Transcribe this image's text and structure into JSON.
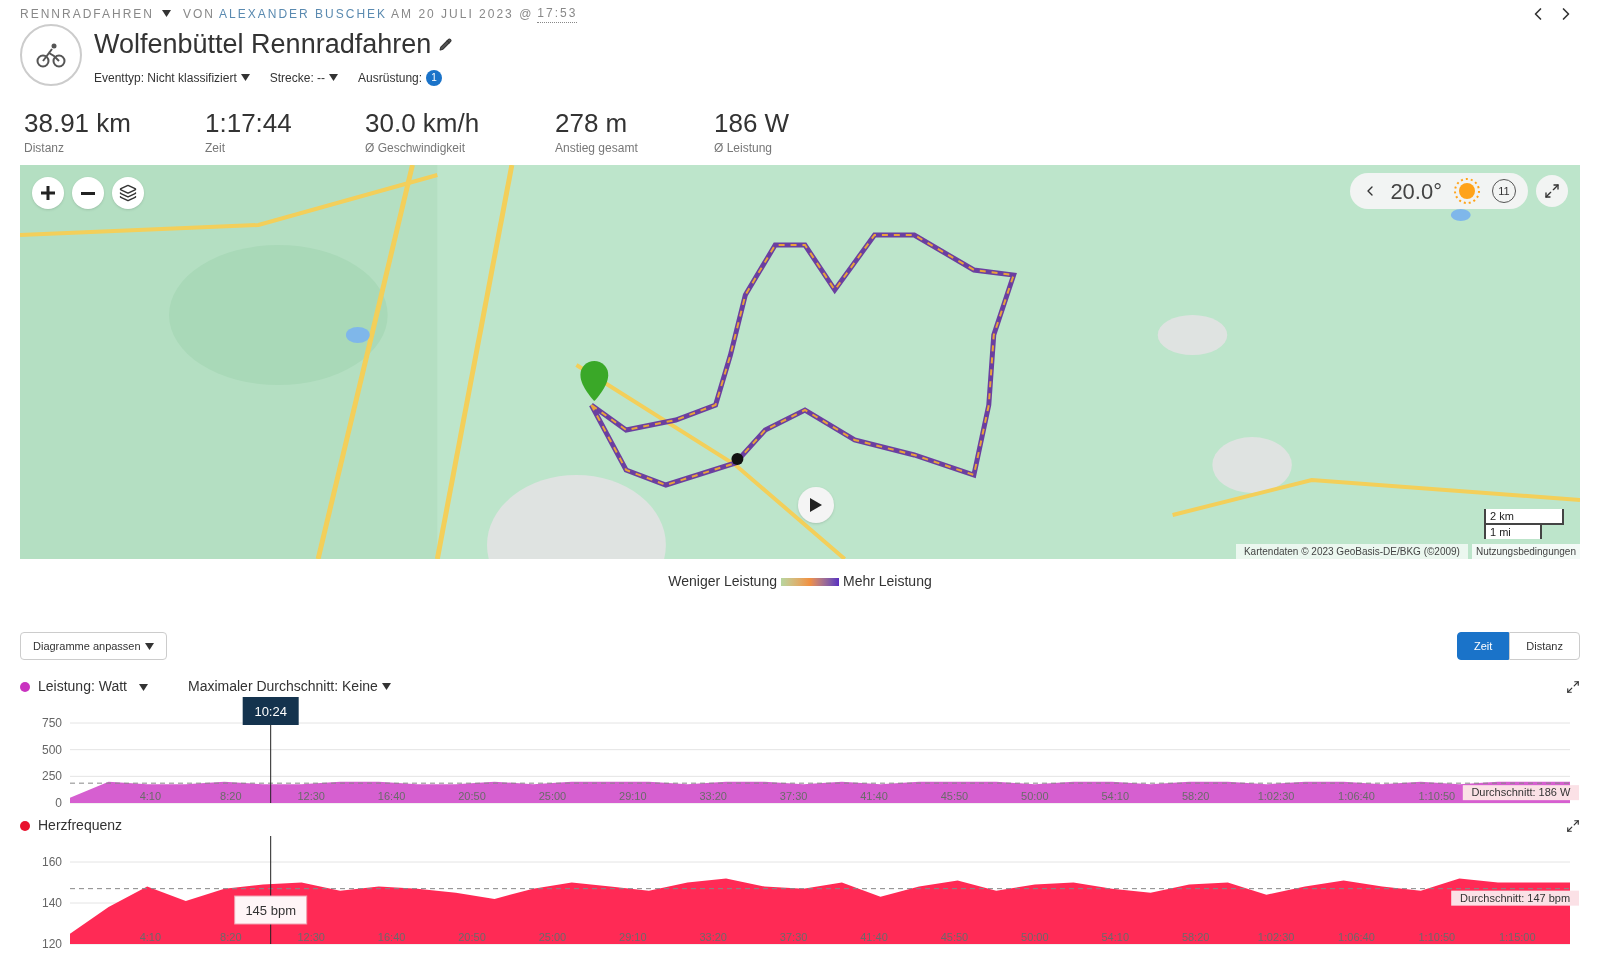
{
  "header": {
    "sport": "RENNRADFAHREN",
    "by": "VON",
    "author": "ALEXANDER BUSCHEK",
    "date": "AM 20 JULI 2023 @",
    "time": "17:53"
  },
  "title": "Wolfenbüttel Rennradfahren",
  "meta": [
    {
      "kind": "dropdown",
      "label": "Eventtyp: Nicht klassifiziert"
    },
    {
      "kind": "dropdown",
      "label": "Strecke: --"
    },
    {
      "kind": "badge",
      "label": "Ausrüstung:",
      "badge": "1"
    }
  ],
  "stats": [
    {
      "value": "38.91 km",
      "label": "Distanz"
    },
    {
      "value": "1:17:44",
      "label": "Zeit"
    },
    {
      "value": "30.0 km/h",
      "label": "Ø Geschwindigkeit"
    },
    {
      "value": "278 m",
      "label": "Anstieg gesamt"
    },
    {
      "value": "186 W",
      "label": "Ø Leistung"
    }
  ],
  "map": {
    "kind": "picture",
    "weather": {
      "temperature": "20.0°",
      "wind": "11"
    },
    "scale": [
      "2 km",
      "1 mi"
    ],
    "attribution": "Kartendaten © 2023 GeoBasis-DE/BKG (©2009)",
    "terms": "Nutzungsbedingungen"
  },
  "legend": {
    "low": "Weniger Leistung",
    "high": "Mehr Leistung"
  },
  "customize_button": "Diagramme anpassen",
  "axis_toggle": [
    {
      "label": "Zeit",
      "selected": true
    },
    {
      "label": "Distanz",
      "selected": false
    }
  ],
  "charts": [
    {
      "title": "Leistung: Watt",
      "selector": "Maximaler Durchschnitt: Keine",
      "color": "#c933c0",
      "cursor_label": "10:24",
      "chart_data": {
        "type": "area",
        "x": [
          0,
          120,
          240,
          360,
          480,
          600,
          720,
          840,
          960,
          1080,
          1200,
          1320,
          1440,
          1560,
          1680,
          1800,
          1920,
          2040,
          2160,
          2280,
          2400,
          2520,
          2640,
          2760,
          2880,
          3000,
          3120,
          3240,
          3360,
          3480,
          3600,
          3720,
          3840,
          3960,
          4080,
          4200,
          4320,
          4440,
          4560,
          4664
        ],
        "series": [
          {
            "color": "#d65fd0",
            "values": [
              50,
              200,
              175,
              175,
              200,
              175,
              175,
              200,
              200,
              175,
              175,
              200,
              175,
              200,
              200,
              200,
              175,
              200,
              200,
              175,
              200,
              175,
              200,
              200,
              200,
              175,
              200,
              200,
              175,
              200,
              200,
              175,
              200,
              200,
              175,
              200,
              175,
              200,
              200,
              200
            ]
          }
        ],
        "xlim": [
          0,
          4664
        ],
        "ylim": [
          0,
          750
        ],
        "yticks": [
          0,
          250,
          500,
          750
        ],
        "xticks": [
          {
            "value": 250,
            "label": "4:10"
          },
          {
            "value": 500,
            "label": "8:20"
          },
          {
            "value": 750,
            "label": "12:30"
          },
          {
            "value": 1000,
            "label": "16:40"
          },
          {
            "value": 1250,
            "label": "20:50"
          },
          {
            "value": 1500,
            "label": "25:00"
          },
          {
            "value": 1750,
            "label": "29:10"
          },
          {
            "value": 2000,
            "label": "33:20"
          },
          {
            "value": 2250,
            "label": "37:30"
          },
          {
            "value": 2500,
            "label": "41:40"
          },
          {
            "value": 2750,
            "label": "45:50"
          },
          {
            "value": 3000,
            "label": "50:00"
          },
          {
            "value": 3250,
            "label": "54:10"
          },
          {
            "value": 3500,
            "label": "58:20"
          },
          {
            "value": 3750,
            "label": "1:02:30"
          },
          {
            "value": 4000,
            "label": "1:06:40"
          },
          {
            "value": 4250,
            "label": "1:10:50"
          }
        ],
        "ref_lines": [
          {
            "axis": "y",
            "value": 186,
            "label": "Durchschnitt: 186 W"
          },
          {
            "axis": "x",
            "value": 624
          }
        ]
      }
    },
    {
      "title": "Herzfrequenz",
      "color": "#e8112d",
      "cursor_label": "145 bpm",
      "chart_data": {
        "type": "area",
        "x": [
          0,
          120,
          240,
          360,
          480,
          600,
          720,
          840,
          960,
          1080,
          1200,
          1320,
          1440,
          1560,
          1680,
          1800,
          1920,
          2040,
          2160,
          2280,
          2400,
          2520,
          2640,
          2760,
          2880,
          3000,
          3120,
          3240,
          3360,
          3480,
          3600,
          3720,
          3840,
          3960,
          4080,
          4200,
          4320,
          4440,
          4560,
          4664
        ],
        "series": [
          {
            "color": "#ff2a55",
            "values": [
              125,
              138,
              148,
              141,
              147,
              149,
              150,
              146,
              148,
              147,
              145,
              142,
              147,
              150,
              148,
              146,
              150,
              152,
              148,
              147,
              150,
              143,
              148,
              151,
              146,
              149,
              150,
              147,
              145,
              149,
              150,
              144,
              148,
              151,
              148,
              146,
              152,
              150,
              150,
              150
            ]
          }
        ],
        "xlim": [
          0,
          4664
        ],
        "ylim": [
          120,
          160
        ],
        "yticks": [
          120,
          140,
          160
        ],
        "xticks": [
          {
            "value": 250,
            "label": "4:10"
          },
          {
            "value": 500,
            "label": "8:20"
          },
          {
            "value": 750,
            "label": "12:30"
          },
          {
            "value": 1000,
            "label": "16:40"
          },
          {
            "value": 1250,
            "label": "20:50"
          },
          {
            "value": 1500,
            "label": "25:00"
          },
          {
            "value": 1750,
            "label": "29:10"
          },
          {
            "value": 2000,
            "label": "33:20"
          },
          {
            "value": 2250,
            "label": "37:30"
          },
          {
            "value": 2500,
            "label": "41:40"
          },
          {
            "value": 2750,
            "label": "45:50"
          },
          {
            "value": 3000,
            "label": "50:00"
          },
          {
            "value": 3250,
            "label": "54:10"
          },
          {
            "value": 3500,
            "label": "58:20"
          },
          {
            "value": 3750,
            "label": "1:02:30"
          },
          {
            "value": 4000,
            "label": "1:06:40"
          },
          {
            "value": 4250,
            "label": "1:10:50"
          },
          {
            "value": 4500,
            "label": "1:15:00"
          }
        ],
        "ref_lines": [
          {
            "axis": "y",
            "value": 147,
            "label": "Durchschnitt: 147 bpm"
          },
          {
            "axis": "x",
            "value": 624
          }
        ]
      }
    }
  ]
}
